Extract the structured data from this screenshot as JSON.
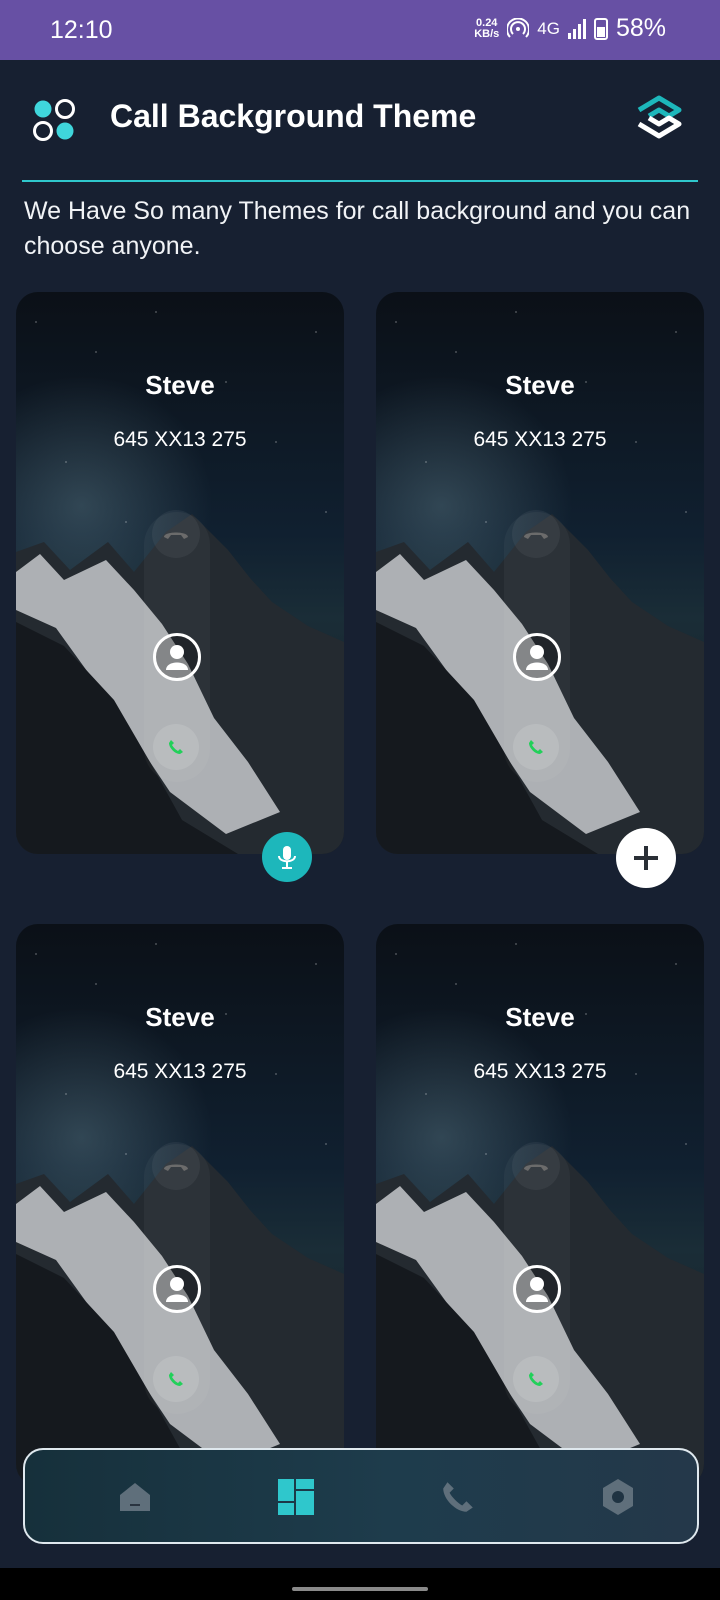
{
  "status_bar": {
    "time": "12:10",
    "net_speed_value": "0.24",
    "net_speed_unit": "KB/s",
    "network": "4G",
    "battery": "58%"
  },
  "header": {
    "title": "Call Background Theme",
    "subtitle": "We Have So many Themes for call background and you can choose anyone."
  },
  "themes": [
    {
      "name": "Steve",
      "number": "645 XX13 275",
      "action": "mic-icon"
    },
    {
      "name": "Steve",
      "number": "645 XX13 275",
      "action": "plus-icon"
    },
    {
      "name": "Steve",
      "number": "645 XX13 275"
    },
    {
      "name": "Steve",
      "number": "645 XX13 275"
    }
  ],
  "bottom_nav": [
    {
      "icon": "home-icon",
      "active": false
    },
    {
      "icon": "themes-icon",
      "active": true
    },
    {
      "icon": "phone-icon",
      "active": false
    },
    {
      "icon": "settings-icon",
      "active": false
    }
  ],
  "colors": {
    "status_bar": "#6750a4",
    "background": "#172031",
    "accent": "#2fc7cc",
    "accept_green": "#22d05a"
  }
}
